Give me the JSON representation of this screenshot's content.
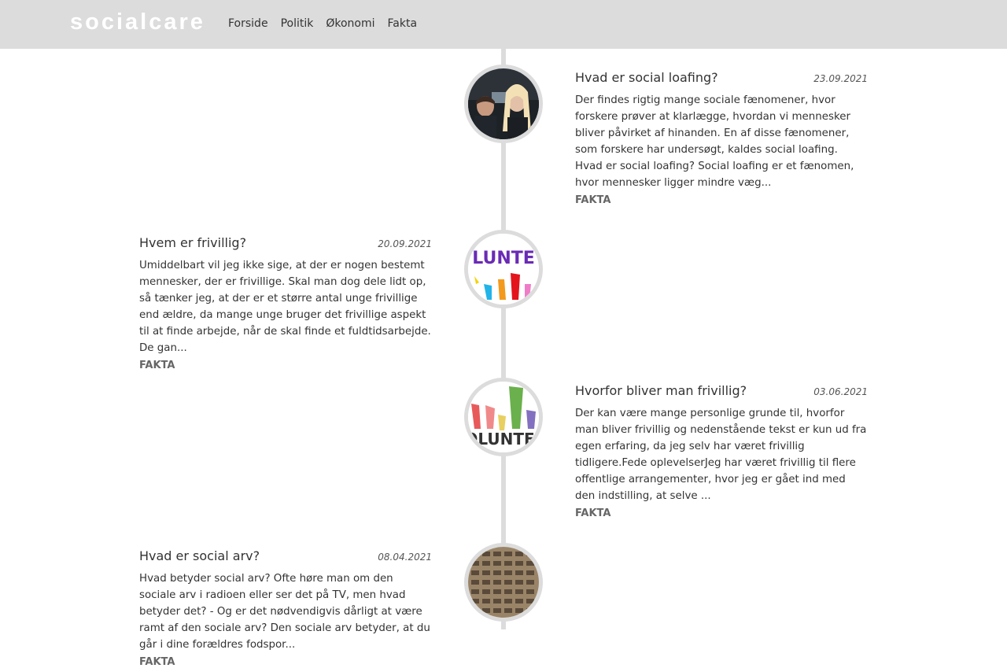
{
  "brand": {
    "logo_text": "socialcare"
  },
  "nav": [
    "Forside",
    "Politik",
    "Økonomi",
    "Fakta"
  ],
  "posts": [
    {
      "title": "Hvad er social loafing?",
      "date": "23.09.2021",
      "excerpt": "Der findes rigtig mange sociale fænomener, hvor forskere prøver at klarlægge, hvordan vi mennesker bliver påvirket af hinanden. En af disse fænomener, som forskere har undersøgt, kaldes social loafing. Hvad er social loafing? Social loafing er et fænomen, hvor mennesker ligger mindre væg...",
      "category": "FAKTA"
    },
    {
      "title": "Hvem er frivillig?",
      "date": "20.09.2021",
      "excerpt": "Umiddelbart vil jeg ikke sige, at der er nogen bestemt mennesker, der er frivillige. Skal man dog dele lidt op, så tænker jeg, at der er et større antal unge frivillige end ældre, da mange unge bruger det frivillige aspekt til at finde arbejde, når de skal finde et fuldtidsarbejde. De gan...",
      "category": "FAKTA",
      "thumb_text": "LUNTE"
    },
    {
      "title": "Hvorfor bliver man frivillig?",
      "date": "03.06.2021",
      "excerpt": "Der kan være mange personlige grunde til, hvorfor man bliver frivillig og nedenstående tekst er kun ud fra egen erfaring, da jeg selv har været frivillig tidligere.Fede oplevelserJeg har været frivillig til flere offentlige arrangementer, hvor jeg er gået ind med den indstilling, at selve ...",
      "category": "FAKTA",
      "thumb_text": "OLUNTE"
    },
    {
      "title": "Hvad er social arv?",
      "date": "08.04.2021",
      "excerpt": "Hvad betyder social arv? Ofte høre man om den sociale arv i radioen eller ser det på TV, men hvad betyder det? - Og er det nødvendigvis dårligt at være ramt af den sociale arv? Den sociale arv betyder, at du går i dine forældres fodspor...",
      "category": "FAKTA"
    }
  ]
}
